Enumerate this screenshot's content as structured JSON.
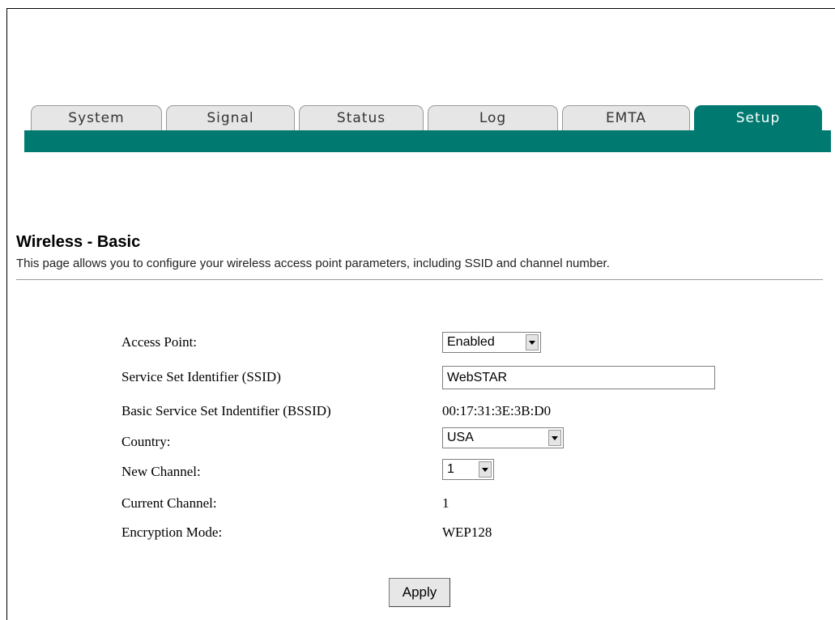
{
  "tabs": [
    {
      "label": "System",
      "active": false
    },
    {
      "label": "Signal",
      "active": false
    },
    {
      "label": "Status",
      "active": false
    },
    {
      "label": "Log",
      "active": false
    },
    {
      "label": "EMTA",
      "active": false
    },
    {
      "label": "Setup",
      "active": true
    }
  ],
  "page": {
    "title": "Wireless - Basic",
    "description": "This page allows you to configure your wireless access point parameters, including SSID and channel number."
  },
  "form": {
    "access_point": {
      "label": "Access Point:",
      "value": "Enabled"
    },
    "ssid": {
      "label": "Service Set Identifier (SSID)",
      "value": "WebSTAR"
    },
    "bssid": {
      "label": "Basic Service Set Indentifier (BSSID)",
      "value": "00:17:31:3E:3B:D0"
    },
    "country": {
      "label": "Country:",
      "value": "USA"
    },
    "new_channel": {
      "label": "New Channel:",
      "value": "1"
    },
    "current_channel": {
      "label": "Current Channel:",
      "value": "1"
    },
    "encryption_mode": {
      "label": "Encryption Mode:",
      "value": "WEP128"
    }
  },
  "buttons": {
    "apply_label": "Apply"
  },
  "colors": {
    "accent": "#007a70",
    "tab_inactive": "#e6e6e6"
  }
}
